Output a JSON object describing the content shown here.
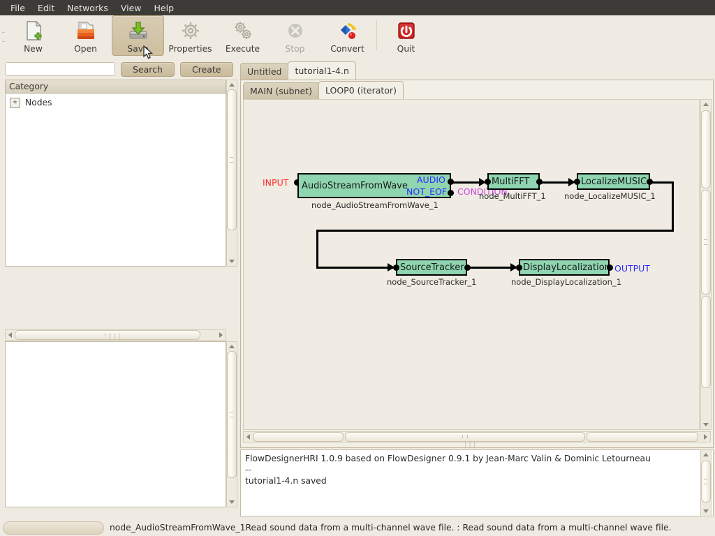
{
  "menubar": {
    "items": [
      {
        "label": "File"
      },
      {
        "label": "Edit"
      },
      {
        "label": "Networks"
      },
      {
        "label": "View"
      },
      {
        "label": "Help"
      }
    ]
  },
  "toolbar": {
    "buttons": [
      {
        "label": "New",
        "icon": "new-document-icon",
        "state": "normal"
      },
      {
        "label": "Open",
        "icon": "open-folder-icon",
        "state": "normal"
      },
      {
        "label": "Save",
        "icon": "save-disk-icon",
        "state": "hover"
      },
      {
        "label": "Properties",
        "icon": "gear-icon",
        "state": "normal"
      },
      {
        "label": "Execute",
        "icon": "gears-icon",
        "state": "normal"
      },
      {
        "label": "Stop",
        "icon": "stop-circle-icon",
        "state": "disabled"
      },
      {
        "label": "Convert",
        "icon": "convert-icon",
        "state": "normal"
      },
      {
        "label": "Quit",
        "icon": "power-icon",
        "state": "normal"
      }
    ]
  },
  "search": {
    "value": "",
    "placeholder": "",
    "search_label": "Search",
    "create_label": "Create"
  },
  "sidebar": {
    "category_header": "Category",
    "tree": [
      {
        "label": "Nodes",
        "expander": "+"
      }
    ]
  },
  "file_tabs": {
    "items": [
      {
        "label": "Untitled",
        "active": false
      },
      {
        "label": "tutorial1-4.n",
        "active": true
      }
    ]
  },
  "subnet_tabs": {
    "items": [
      {
        "label": "MAIN (subnet)",
        "active": false
      },
      {
        "label": "LOOP0 (iterator)",
        "active": true
      }
    ]
  },
  "colors": {
    "node_fill": "#8ed5b0",
    "input_label": "#ff2a2a",
    "output_label": "#2a2aff",
    "port_label": "#2a2aff",
    "condition_label": "#cc44dd",
    "canvas_bg": "#f0ece3",
    "chrome_bg": "#efebe2",
    "menubar_bg": "#3c3b37"
  },
  "graph": {
    "nodes": [
      {
        "title": "AudioStreamFromWave",
        "caption": "node_AudioStreamFromWave_1"
      },
      {
        "title": "MultiFFT",
        "caption": "node_MultiFFT_1"
      },
      {
        "title": "LocalizeMUSIC",
        "caption": "node_LocalizeMUSIC_1"
      },
      {
        "title": "SourceTracker",
        "caption": "node_SourceTracker_1"
      },
      {
        "title": "DisplayLocalization",
        "caption": "node_DisplayLocalization_1"
      }
    ],
    "labels": {
      "input": "INPUT",
      "output": "OUTPUT",
      "audio": "AUDIO",
      "not_eof": "NOT_EOF",
      "condition": "CONDITION"
    }
  },
  "console": {
    "lines": [
      "FlowDesignerHRI 1.0.9 based on FlowDesigner 0.9.1 by Jean-Marc Valin & Dominic Letourneau",
      "--",
      "tutorial1-4.n saved"
    ]
  },
  "statusbar": {
    "text": "node_AudioStreamFromWave_1Read sound data from a multi-channel wave file. : Read sound data from a multi-channel wave file."
  }
}
